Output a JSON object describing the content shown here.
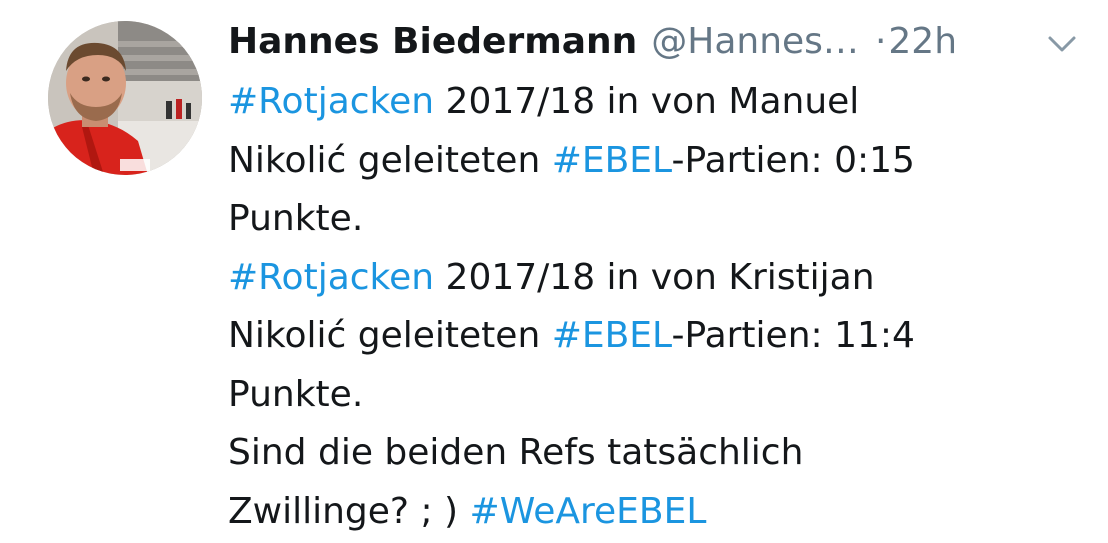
{
  "tweet": {
    "author_name": "Hannes Biedermann",
    "author_handle": "@Hannes…",
    "separator": "·",
    "time": "22h",
    "lines": [
      {
        "hashtag": "#Rotjacken",
        "text": " 2017/18 in von Manuel"
      },
      {
        "pre": "Nikolić geleiteten ",
        "hashtag": "#EBEL",
        "text": "-Partien: 0:15"
      },
      {
        "text": "Punkte."
      },
      {
        "hashtag": "#Rotjacken",
        "text": " 2017/18 in von Kristijan"
      },
      {
        "pre": "Nikolić geleiteten ",
        "hashtag": "#EBEL",
        "text": "-Partien: 11:4"
      },
      {
        "text": "Punkte."
      },
      {
        "text": "Sind die beiden Refs tatsächlich"
      },
      {
        "pre": "Zwillinge? ; ) ",
        "hashtag": "#WeAreEBEL"
      }
    ]
  },
  "icons": {
    "menu_caret": "chevron-down-icon",
    "avatar": "profile-photo"
  },
  "colors": {
    "hashtag": "#1b95e0",
    "secondary_text": "#657786",
    "primary_text": "#14171a",
    "background": "#ffffff"
  }
}
